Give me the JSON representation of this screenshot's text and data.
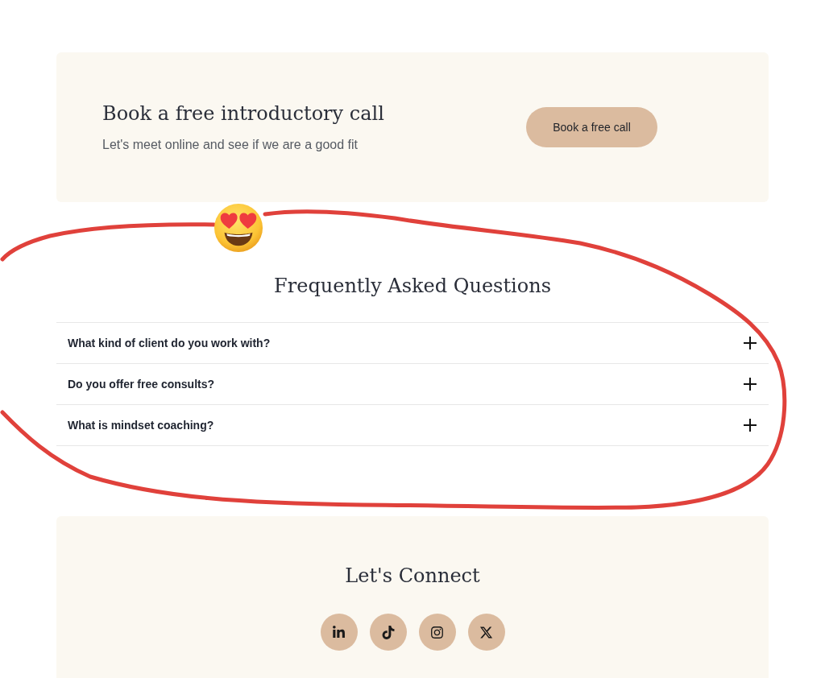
{
  "cta": {
    "title": "Book a free introductory call",
    "subtitle": "Let's meet online and see if we are a good fit",
    "button": "Book a free call"
  },
  "faq": {
    "title": "Frequently Asked Questions",
    "items": [
      {
        "question": "What kind of client do you work with?",
        "expanded": false
      },
      {
        "question": "Do you offer free consults?",
        "expanded": false
      },
      {
        "question": "What is mindset coaching?",
        "expanded": false
      }
    ]
  },
  "connect": {
    "title": "Let's Connect",
    "socials": [
      {
        "kind": "linkedin"
      },
      {
        "kind": "tiktok"
      },
      {
        "kind": "instagram"
      },
      {
        "kind": "x"
      }
    ]
  }
}
